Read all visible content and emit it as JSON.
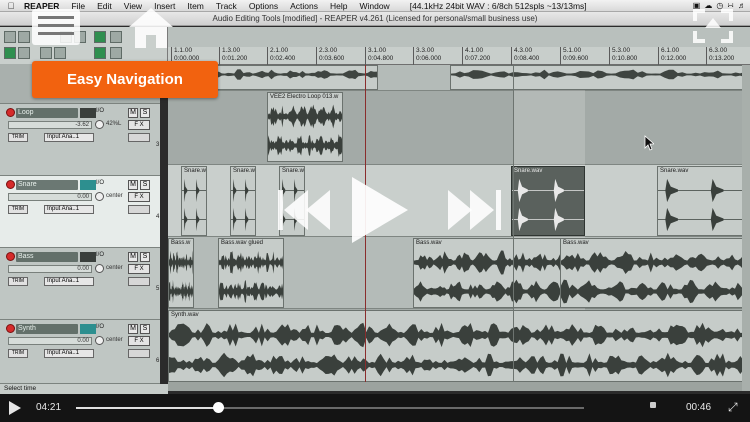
{
  "menubar": {
    "app": "REAPER",
    "items": [
      "File",
      "Edit",
      "View",
      "Insert",
      "Item",
      "Track",
      "Options",
      "Actions",
      "Help",
      "Window"
    ],
    "status": "[44.1kHz 24bit WAV : 6/8ch 512spls ~13/13ms]"
  },
  "window_title": "Audio Editing Tools [modified] - REAPER v4.261 (Licensed for personal/small business use)",
  "ruler": {
    "ticks": [
      {
        "bar": "1.1.00",
        "time": "0:00.000"
      },
      {
        "bar": "1.3.00",
        "time": "0:01.200"
      },
      {
        "bar": "2.1.00",
        "time": "0:02.400"
      },
      {
        "bar": "2.3.00",
        "time": "0:03.600"
      },
      {
        "bar": "3.1.00",
        "time": "0:04.800"
      },
      {
        "bar": "3.3.00",
        "time": "0:06.000"
      },
      {
        "bar": "4.1.00",
        "time": "0:07.200"
      },
      {
        "bar": "4.3.00",
        "time": "0:08.400"
      },
      {
        "bar": "5.1.00",
        "time": "0:09.600"
      },
      {
        "bar": "5.3.00",
        "time": "0:10.800"
      },
      {
        "bar": "6.1.00",
        "time": "0:12.000"
      },
      {
        "bar": "6.3.00",
        "time": "0:13.200"
      }
    ]
  },
  "tracks": [
    {
      "name": "Loop",
      "io": "I/O",
      "volume": "-3.62",
      "pan": "42%L",
      "input": "Input Ana..1",
      "number": "3"
    },
    {
      "name": "Snare",
      "io": "I/O",
      "volume": "0.00",
      "pan": "center",
      "input": "Input Ana..1",
      "number": "4"
    },
    {
      "name": "Bass",
      "io": "I/O",
      "volume": "0.00",
      "pan": "center",
      "input": "Input Ana..1",
      "number": "5"
    },
    {
      "name": "Synth",
      "io": "I/O",
      "volume": "0.00",
      "pan": "center",
      "input": "Input Ana..1",
      "number": "6"
    }
  ],
  "buttons": {
    "mute": "M",
    "solo": "S",
    "fx": "F X",
    "trim": "TRIM"
  },
  "items": {
    "loop": "VEE2 Electro Loop 013.w",
    "snare_short": "Snare.w",
    "snare_full": "Snare.wav",
    "bass_short": "Bass.w",
    "bass_glued": "Bass.wav glued",
    "bass_full": "Bass.wav",
    "synth": "Synth.wav"
  },
  "status_bar": "Select time",
  "overlay": {
    "banner": "Easy Navigation"
  },
  "video": {
    "elapsed": "04:21",
    "remaining": "00:46",
    "progress": 0.28
  }
}
